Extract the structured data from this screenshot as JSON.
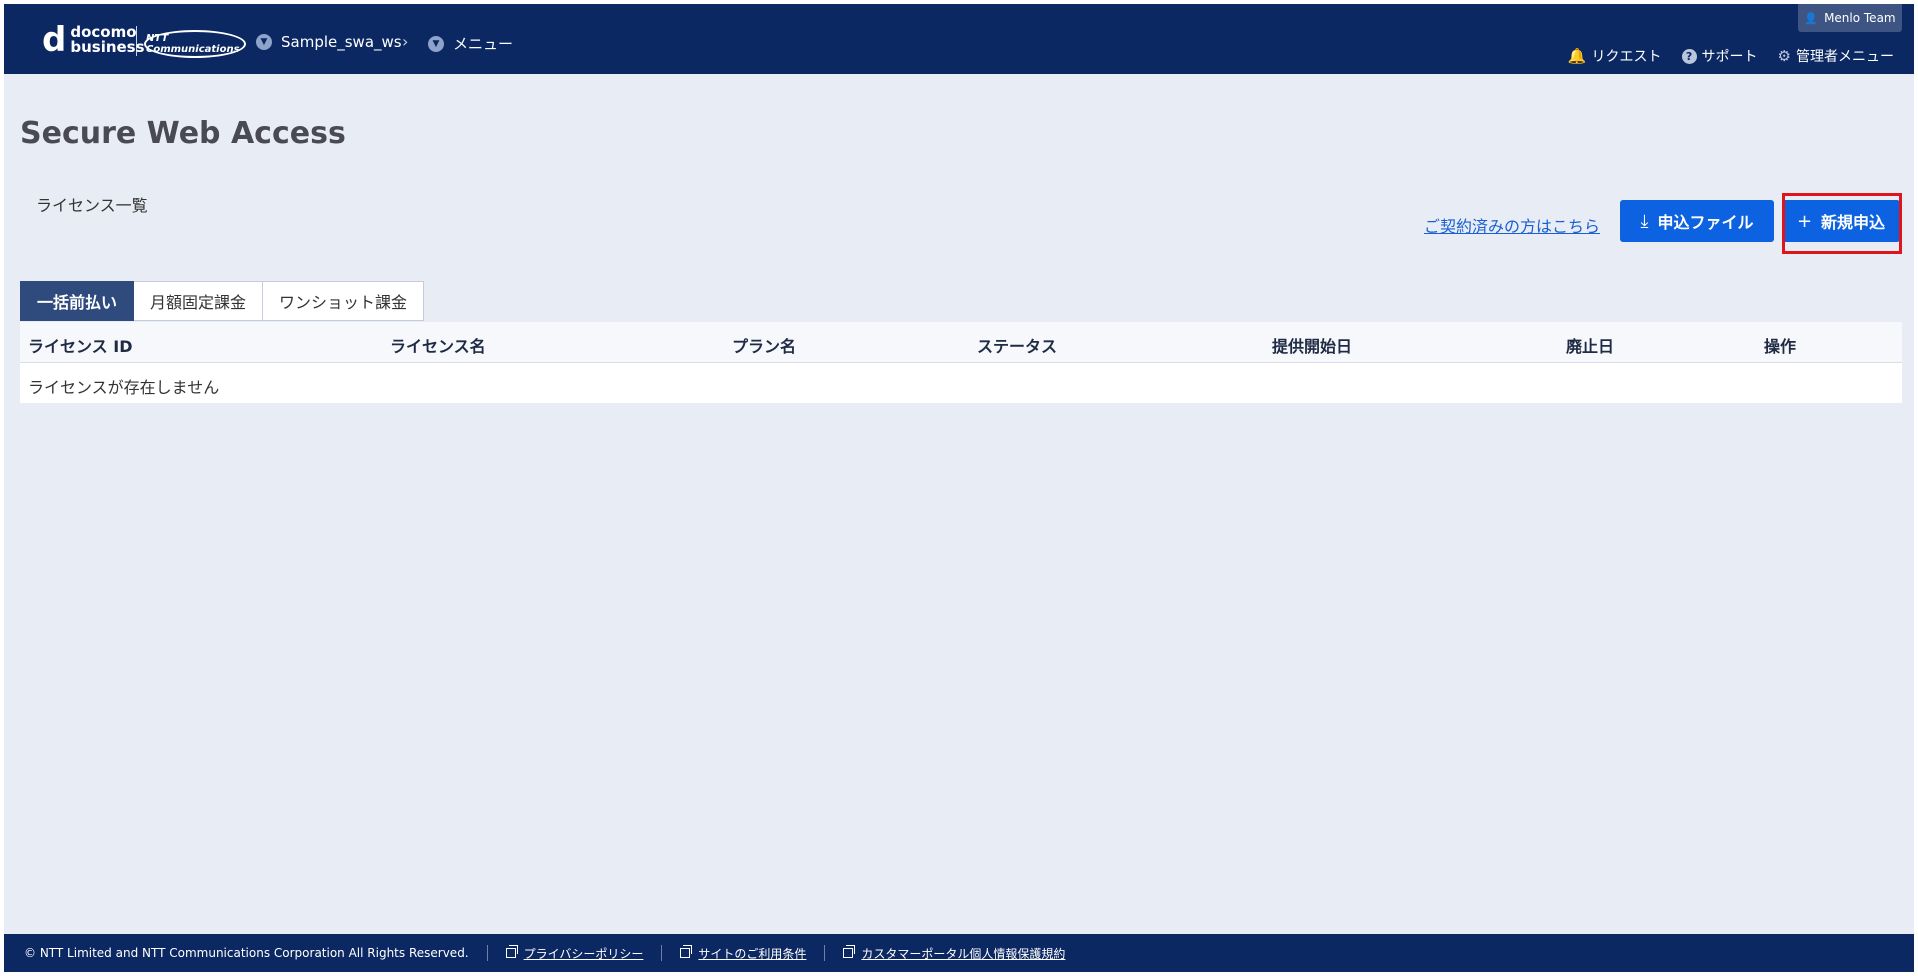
{
  "header": {
    "logo_docomo_top": "docomo",
    "logo_docomo_bottom": "business",
    "logo_ntt": "NTT Communications",
    "breadcrumb": [
      {
        "label": "Sample_swa_ws"
      },
      {
        "label": "メニュー"
      }
    ],
    "user_label": "Menlo Team",
    "links": {
      "request": "リクエスト",
      "support": "サポート",
      "admin_menu": "管理者メニュー"
    }
  },
  "main": {
    "title": "Secure Web Access",
    "section_label": "ライセンス一覧",
    "contract_link": "ご契約済みの方はこちら",
    "btn_file": "申込ファイル",
    "btn_new": "新規申込",
    "tabs": [
      {
        "label": "一括前払い",
        "active": true
      },
      {
        "label": "月額固定課金",
        "active": false
      },
      {
        "label": "ワンショット課金",
        "active": false
      }
    ],
    "table": {
      "headers": {
        "license_id": "ライセンス ID",
        "license_name": "ライセンス名",
        "plan_name": "プラン名",
        "status": "ステータス",
        "start_date": "提供開始日",
        "end_date": "廃止日",
        "action": "操作"
      },
      "empty_message": "ライセンスが存在しません"
    }
  },
  "footer": {
    "copyright": "© NTT Limited and NTT Communications Corporation All Rights Reserved.",
    "privacy": "プライバシーポリシー",
    "terms": "サイトのご利用条件",
    "customer_privacy": "カスタマーポータル個人情報保護規約"
  },
  "colors": {
    "header_bg": "#0b2862",
    "primary_button": "#0c62e0",
    "active_tab": "#2f4a7c",
    "highlight": "#e0151b"
  }
}
